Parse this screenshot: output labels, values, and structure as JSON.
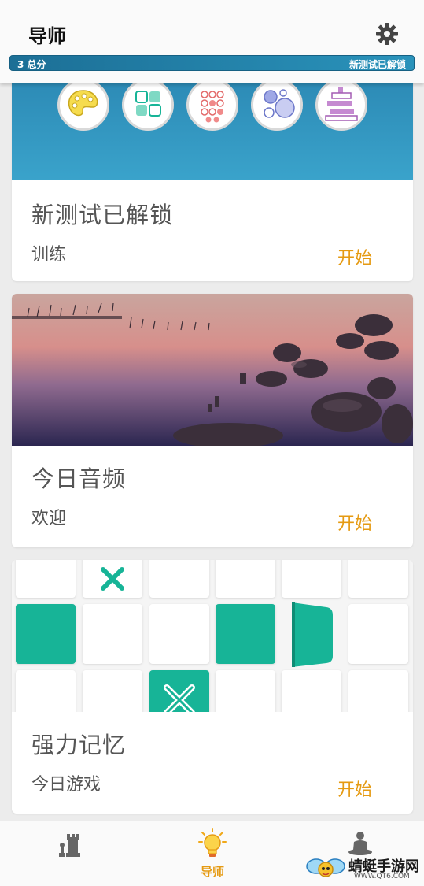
{
  "header": {
    "title": "导师",
    "settings_icon": "gear-icon"
  },
  "progress": {
    "score_label": "3 总分",
    "unlock_label": "新测试已解锁",
    "colors": {
      "bar": "#1c6f96"
    }
  },
  "cards": [
    {
      "title": "新测试已解锁",
      "subtitle": "训练",
      "action": "开始",
      "banner_icons": [
        "palette-icon",
        "tiles-grid-icon",
        "dots-grid-icon",
        "bubbles-icon",
        "stacked-blocks-icon"
      ]
    },
    {
      "title": "今日音频",
      "subtitle": "欢迎",
      "action": "开始",
      "image": "lake-sunset-stones-photo"
    },
    {
      "title": "强力记忆",
      "subtitle": "今日游戏",
      "action": "开始",
      "image": "memory-grid-tiles"
    }
  ],
  "bottom_nav": [
    {
      "icon": "chess-rook-icon",
      "label": ""
    },
    {
      "icon": "lightbulb-icon",
      "label": "导师",
      "active": true
    },
    {
      "icon": "meditation-icon",
      "label": ""
    }
  ],
  "watermark": {
    "text": "蜻蜓手游网",
    "url": "WWW.QT6.COM"
  },
  "accent_color": "#e59a12"
}
